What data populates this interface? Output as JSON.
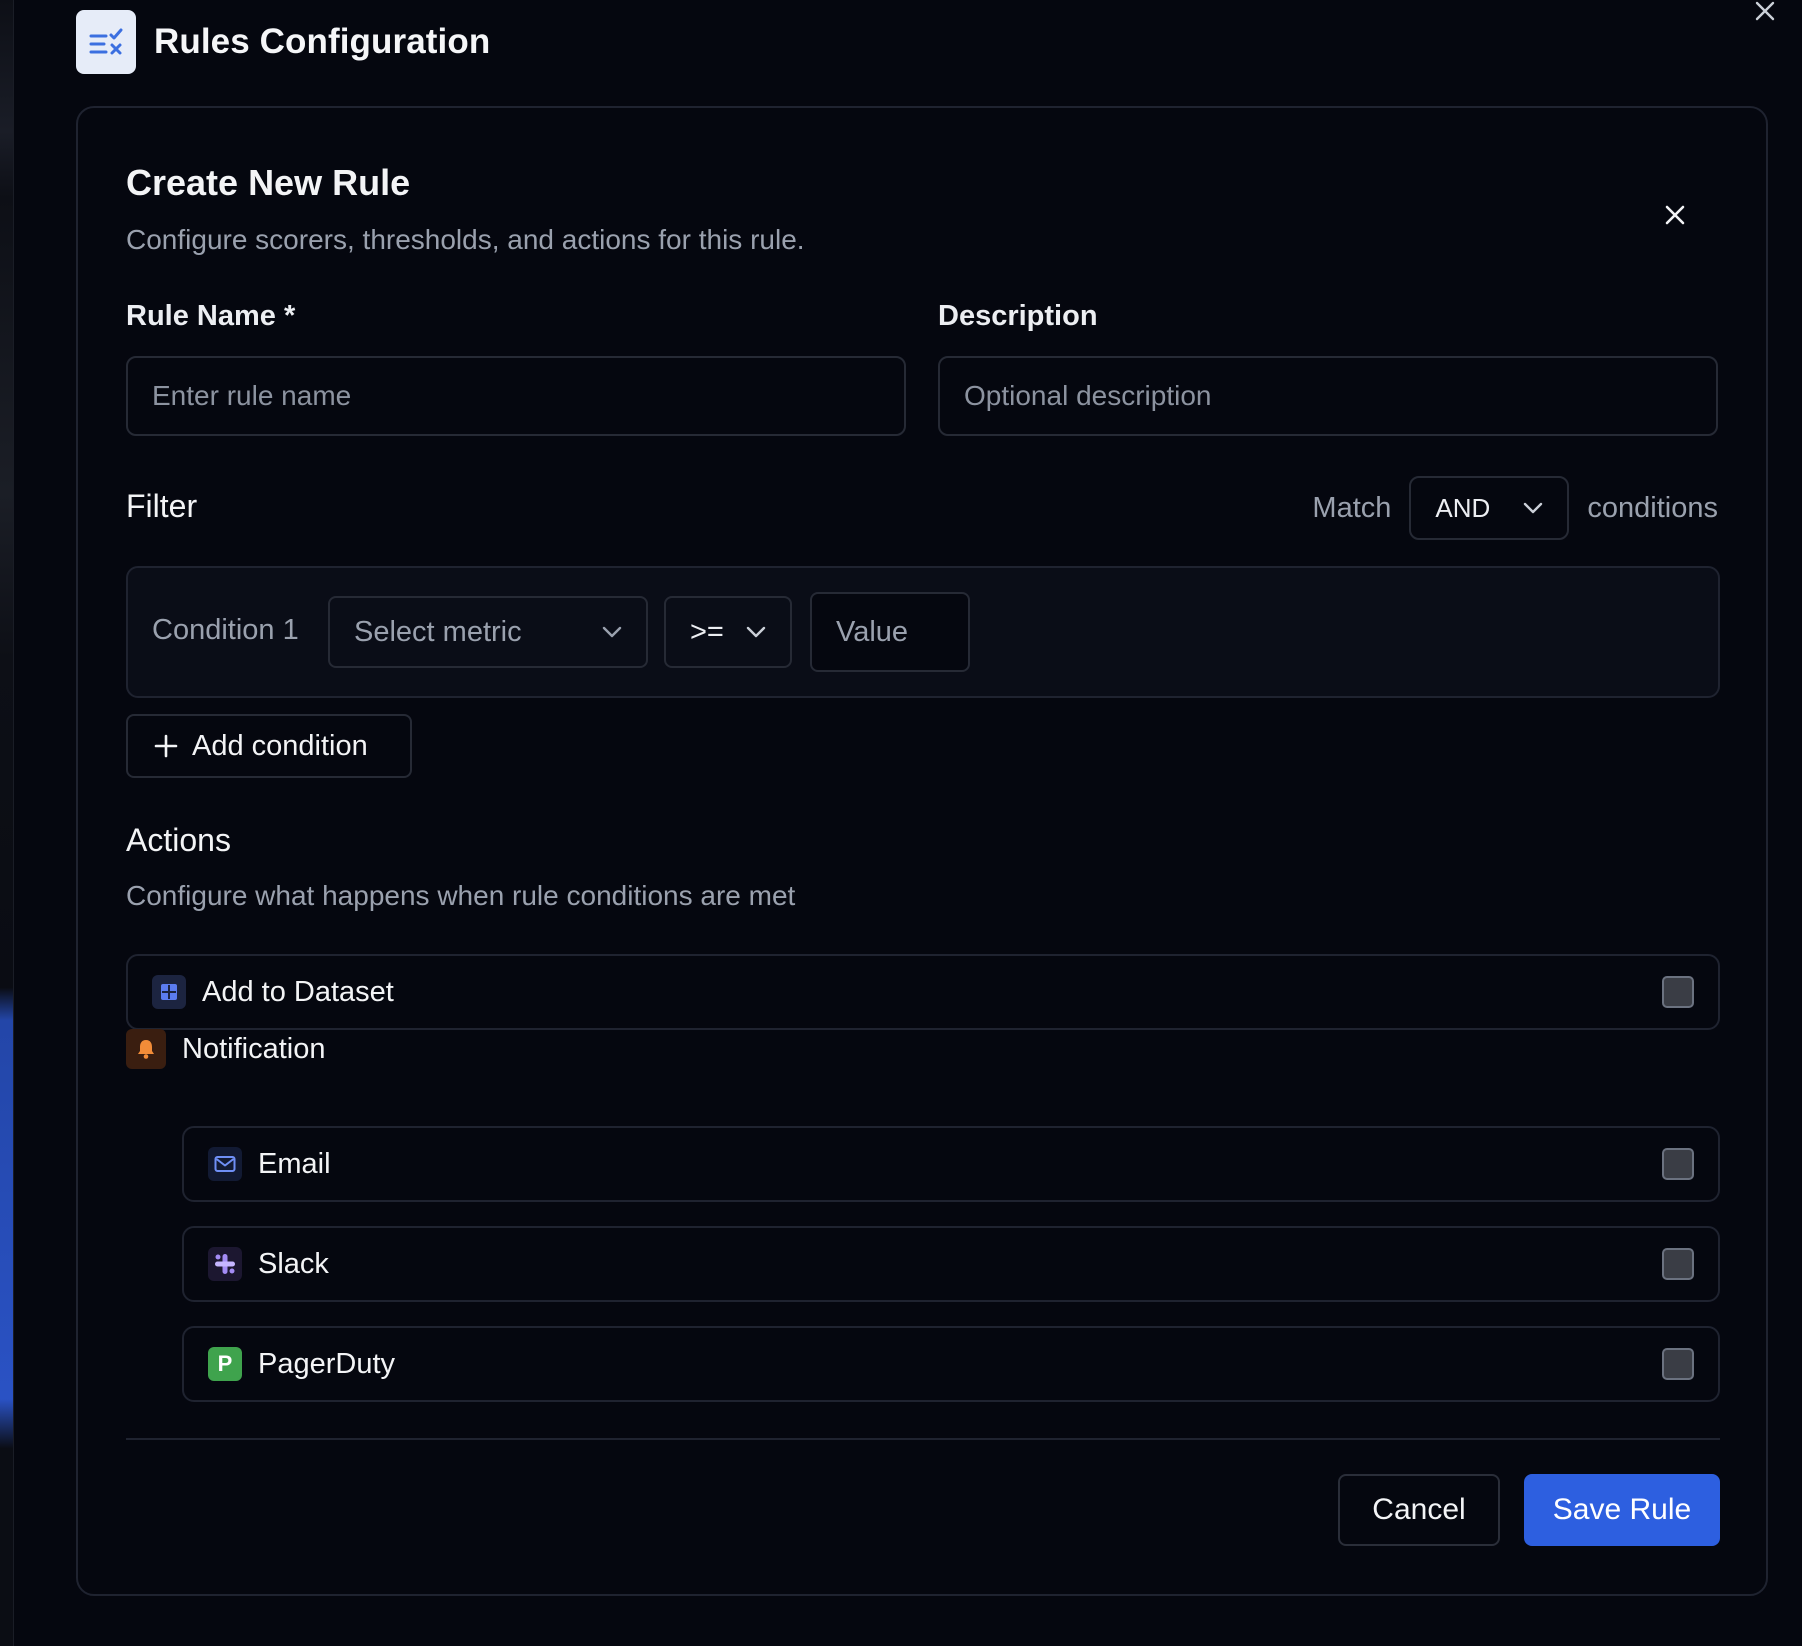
{
  "header": {
    "title": "Rules Configuration",
    "icon": "rules-list-icon"
  },
  "panel": {
    "title": "Create New Rule",
    "subtitle": "Configure scorers, thresholds, and actions for this rule."
  },
  "form": {
    "rule_name_label": "Rule Name *",
    "rule_name_placeholder": "Enter rule name",
    "rule_name_value": "",
    "description_label": "Description",
    "description_placeholder": "Optional description",
    "description_value": ""
  },
  "filter": {
    "title": "Filter",
    "match_label": "Match",
    "match_value": "AND",
    "conditions_label": "conditions",
    "conditions": [
      {
        "label": "Condition 1",
        "metric_placeholder": "Select metric",
        "operator": ">=",
        "value_placeholder": "Value"
      }
    ],
    "add_condition_label": "Add condition"
  },
  "actions": {
    "title": "Actions",
    "subtitle": "Configure what happens when rule conditions are met",
    "add_to_dataset": {
      "label": "Add to Dataset",
      "icon": "dataset-grid-icon",
      "checked": false
    },
    "notification": {
      "label": "Notification",
      "icon": "bell-icon",
      "channels": [
        {
          "label": "Email",
          "icon": "mail-icon",
          "checked": false
        },
        {
          "label": "Slack",
          "icon": "slack-icon",
          "checked": false
        },
        {
          "label": "PagerDuty",
          "icon": "pagerduty-icon",
          "icon_letter": "P",
          "checked": false
        }
      ]
    }
  },
  "footer": {
    "cancel_label": "Cancel",
    "save_label": "Save Rule"
  },
  "colors": {
    "background": "#05070f",
    "accent": "#2d5fe0",
    "pagerduty": "#3fa34d",
    "notification_bell": "#f28c38"
  }
}
